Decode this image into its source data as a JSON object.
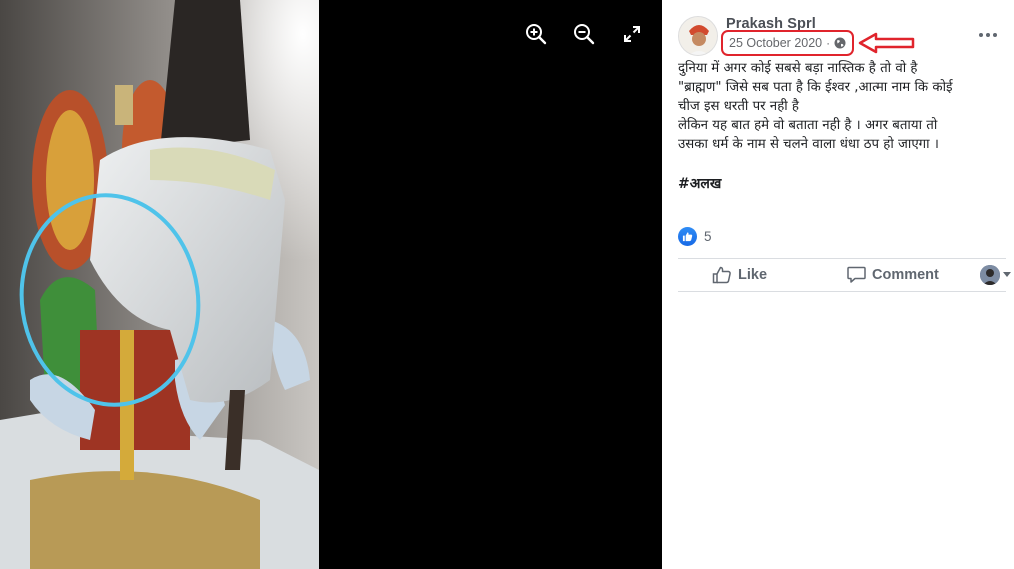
{
  "post": {
    "author": "Prakash Sprl",
    "date": "25 October 2020",
    "separator": "·",
    "lines": [
      "दुनिया में अगर कोई सबसे बड़ा नास्तिक है तो वो है",
      "\"ब्राह्मण\" जिसे सब पता है कि ईश्वर ,आत्मा नाम कि कोई",
      "चीज इस धरती पर नही है",
      "लेकिन यह बात हमे वो बताता नही है । अगर बताया तो",
      "उसका धर्म के नाम से चलने वाला धंधा ठप हो जाएगा ।"
    ],
    "hashtag": "#अलख",
    "reaction_count": "5"
  },
  "actions": {
    "like": "Like",
    "comment": "Comment"
  },
  "icons": {
    "zoom_in": "zoom-in-icon",
    "zoom_out": "zoom-out-icon",
    "fullscreen": "fullscreen-icon",
    "globe": "globe-icon",
    "more": "more-options-icon",
    "like": "thumbs-up-icon",
    "comment": "comment-icon"
  },
  "colors": {
    "highlight_red": "#e0242c",
    "annotation_circle": "#4fc3ea",
    "like_blue": "#1877f2",
    "viewer_bg": "#000000"
  }
}
